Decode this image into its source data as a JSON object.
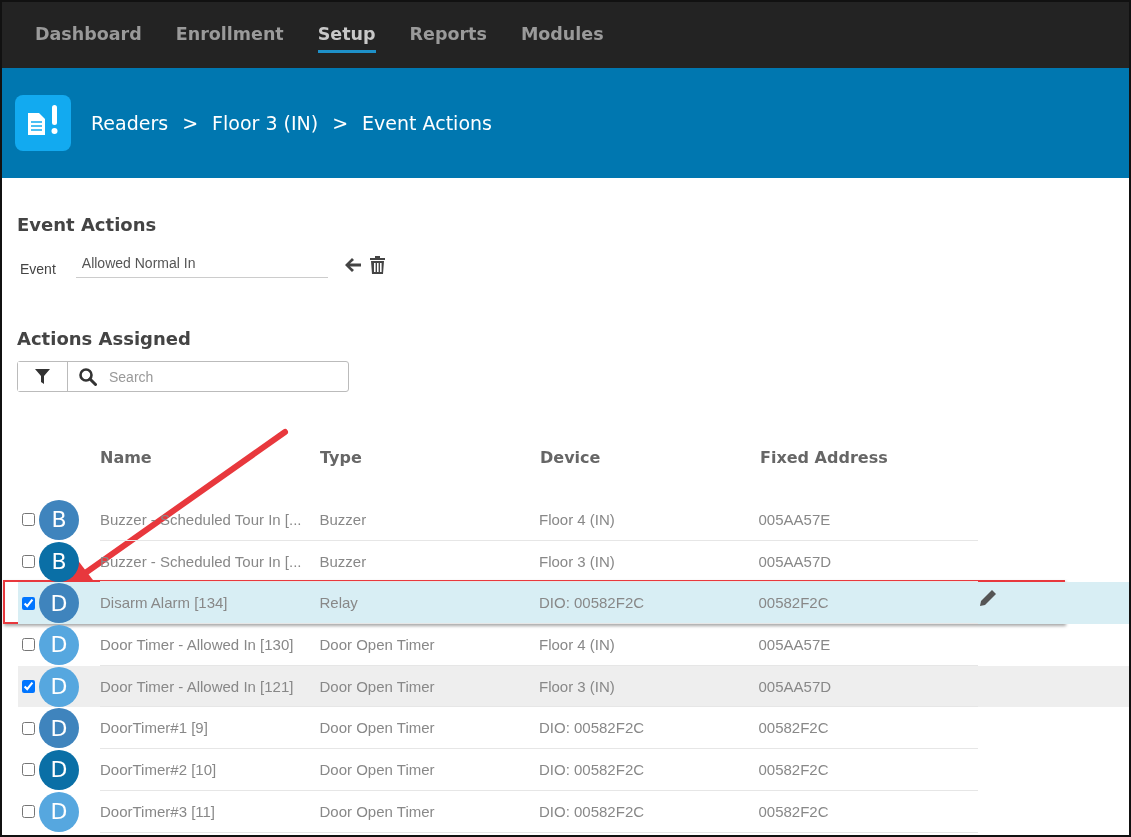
{
  "nav": [
    {
      "label": "Dashboard",
      "selected": false
    },
    {
      "label": "Enrollment",
      "selected": false
    },
    {
      "label": "Setup",
      "selected": true
    },
    {
      "label": "Reports",
      "selected": false
    },
    {
      "label": "Modules",
      "selected": false
    }
  ],
  "breadcrumb": [
    "Readers",
    ">",
    "Floor 3 (IN)",
    ">",
    "Event Actions"
  ],
  "event_actions": {
    "title": "Event Actions",
    "event_label": "Event",
    "event_value": "Allowed Normal In"
  },
  "actions_assigned": {
    "title": "Actions Assigned",
    "search_placeholder": "Search"
  },
  "table": {
    "columns": [
      "Name",
      "Type",
      "Device",
      "Fixed Address"
    ],
    "rows": [
      {
        "initial": "B",
        "color": "#3f84bd",
        "name": "Buzzer - Scheduled Tour In [...",
        "type": "Buzzer",
        "device": "Floor 4 (IN)",
        "address": "005AA57E",
        "checked": false,
        "selected": false,
        "focused": false,
        "annotated": false
      },
      {
        "initial": "B",
        "color": "#0a6fa6",
        "name": "Buzzer - Scheduled Tour In [...",
        "type": "Buzzer",
        "device": "Floor 3 (IN)",
        "address": "005AA57D",
        "checked": false,
        "selected": false,
        "focused": false,
        "annotated": false
      },
      {
        "initial": "D",
        "color": "#3f84bd",
        "name": "Disarm Alarm [134]",
        "type": "Relay",
        "device": "DIO: 00582F2C",
        "address": "00582F2C",
        "checked": true,
        "selected": true,
        "focused": true,
        "annotated": true
      },
      {
        "initial": "D",
        "color": "#56a7df",
        "name": "Door Timer - Allowed In [130]",
        "type": "Door Open Timer",
        "device": "Floor 4 (IN)",
        "address": "005AA57E",
        "checked": false,
        "selected": false,
        "focused": false,
        "annotated": false
      },
      {
        "initial": "D",
        "color": "#56a7df",
        "name": "Door Timer - Allowed In [121]",
        "type": "Door Open Timer",
        "device": "Floor 3 (IN)",
        "address": "005AA57D",
        "checked": true,
        "selected": true,
        "focused": false,
        "annotated": false
      },
      {
        "initial": "D",
        "color": "#3f84bd",
        "name": "DoorTimer#1 [9]",
        "type": "Door Open Timer",
        "device": "DIO: 00582F2C",
        "address": "00582F2C",
        "checked": false,
        "selected": false,
        "focused": false,
        "annotated": false
      },
      {
        "initial": "D",
        "color": "#0a6fa6",
        "name": "DoorTimer#2 [10]",
        "type": "Door Open Timer",
        "device": "DIO: 00582F2C",
        "address": "00582F2C",
        "checked": false,
        "selected": false,
        "focused": false,
        "annotated": false
      },
      {
        "initial": "D",
        "color": "#56a7df",
        "name": "DoorTimer#3 [11]",
        "type": "Door Open Timer",
        "device": "DIO: 00582F2C",
        "address": "00582F2C",
        "checked": false,
        "selected": false,
        "focused": false,
        "annotated": false
      }
    ]
  }
}
